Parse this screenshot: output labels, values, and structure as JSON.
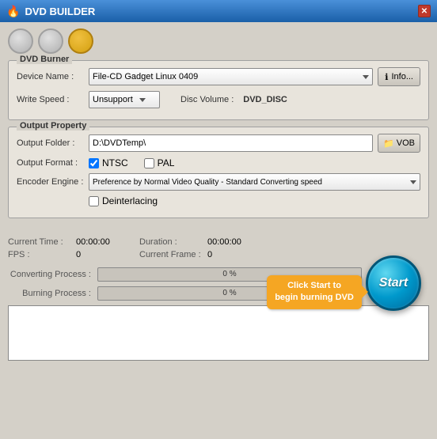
{
  "titleBar": {
    "title": "DVD BUILDER",
    "closeLabel": "✕"
  },
  "windowButtons": {
    "minimize": "",
    "maximize": "",
    "close": ""
  },
  "dvdBurner": {
    "title": "DVD Burner",
    "deviceNameLabel": "Device Name :",
    "deviceNameValue": "File-CD Gadget  Linux   0409",
    "infoButtonLabel": "Info...",
    "writeSpeedLabel": "Write Speed :",
    "writeSpeedValue": "Unsupport",
    "discVolumeLabel": "Disc Volume :",
    "discVolumeValue": "DVD_DISC"
  },
  "outputProperty": {
    "title": "Output Property",
    "outputFolderLabel": "Output Folder :",
    "outputFolderValue": "D:\\DVDTemp\\",
    "vobButtonLabel": "VOB",
    "outputFormatLabel": "Output Format :",
    "ntscLabel": "NTSC",
    "palLabel": "PAL",
    "ntscChecked": true,
    "palChecked": false,
    "encoderEngineLabel": "Encoder Engine :",
    "encoderEngineValue": "Preference by Normal Video Quality - Standard Converting speed",
    "deinterlacingLabel": "Deinterlacing",
    "deinterlacingChecked": false
  },
  "stats": {
    "currentTimeLabel": "Current Time :",
    "currentTimeValue": "00:00:00",
    "durationLabel": "Duration :",
    "durationValue": "00:00:00",
    "fpsLabel": "FPS :",
    "fpsValue": "0",
    "currentFrameLabel": "Current Frame :",
    "currentFrameValue": "0"
  },
  "progress": {
    "convertingLabel": "Converting Process :",
    "convertingValue": "0 %",
    "convertingPercent": 0,
    "burningLabel": "Burning Process :",
    "burningValue": "0 %",
    "burningPercent": 0
  },
  "startButton": {
    "label": "Start"
  },
  "tooltip": {
    "text": "Click Start to begin burning DVD"
  },
  "logArea": {
    "content": ""
  }
}
